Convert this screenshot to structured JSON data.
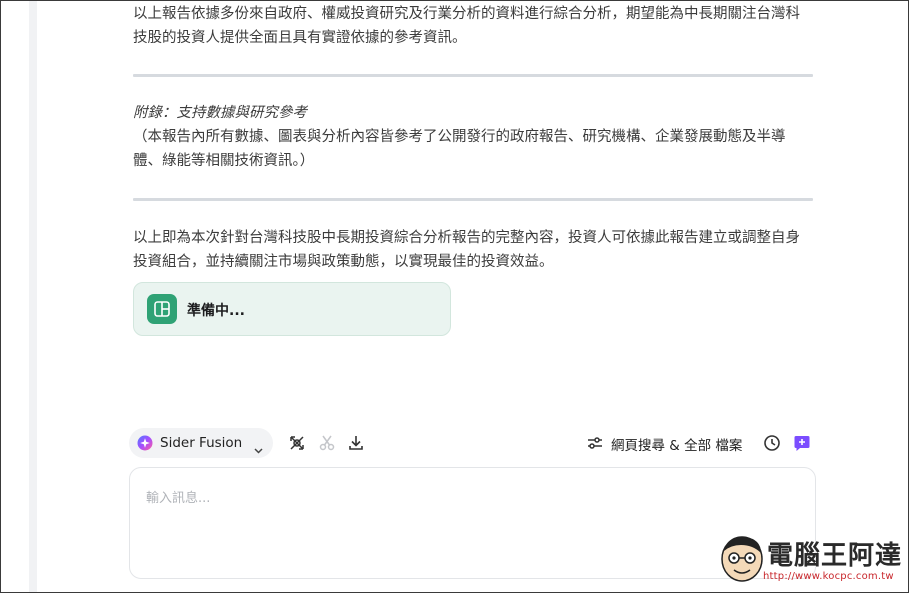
{
  "report": {
    "paragraph_1": "以上報告依據多份來自政府、權威投資研究及行業分析的資料進行綜合分析，期望能為中長期關注台灣科技股的投資人提供全面且具有實證依據的參考資訊。",
    "appendix_title": "附錄：支持數據與研究參考",
    "appendix_body": "（本報告內所有數據、圖表與分析內容皆參考了公開發行的政府報告、研究機構、企業發展動態及半導體、綠能等相關技術資訊。）",
    "paragraph_3": "以上即為本次針對台灣科技股中長期投資綜合分析報告的完整內容，投資人可依據此報告建立或調整自身投資組合，並持續關注市場與政策動態，以實現最佳的投資效益。"
  },
  "status_card": {
    "label": "準備中...",
    "accent_color": "#2fa275",
    "icon": "layout-panel-icon"
  },
  "toolbar": {
    "model_name": "Sider Fusion",
    "model_icon": "sider-fusion-logo-icon",
    "tools": [
      "prompt-library-icon",
      "scissors-icon",
      "download-icon"
    ],
    "search_scope_label": "網頁搜尋 & 全部 檔案",
    "history_icon": "clock-icon",
    "new_chat_icon": "new-chat-icon",
    "new_chat_color": "#7b4dff"
  },
  "chat_input": {
    "placeholder": "輸入訊息..."
  },
  "watermark": {
    "title": "電腦王阿達",
    "url": "http://www.kocpc.com.tw"
  }
}
